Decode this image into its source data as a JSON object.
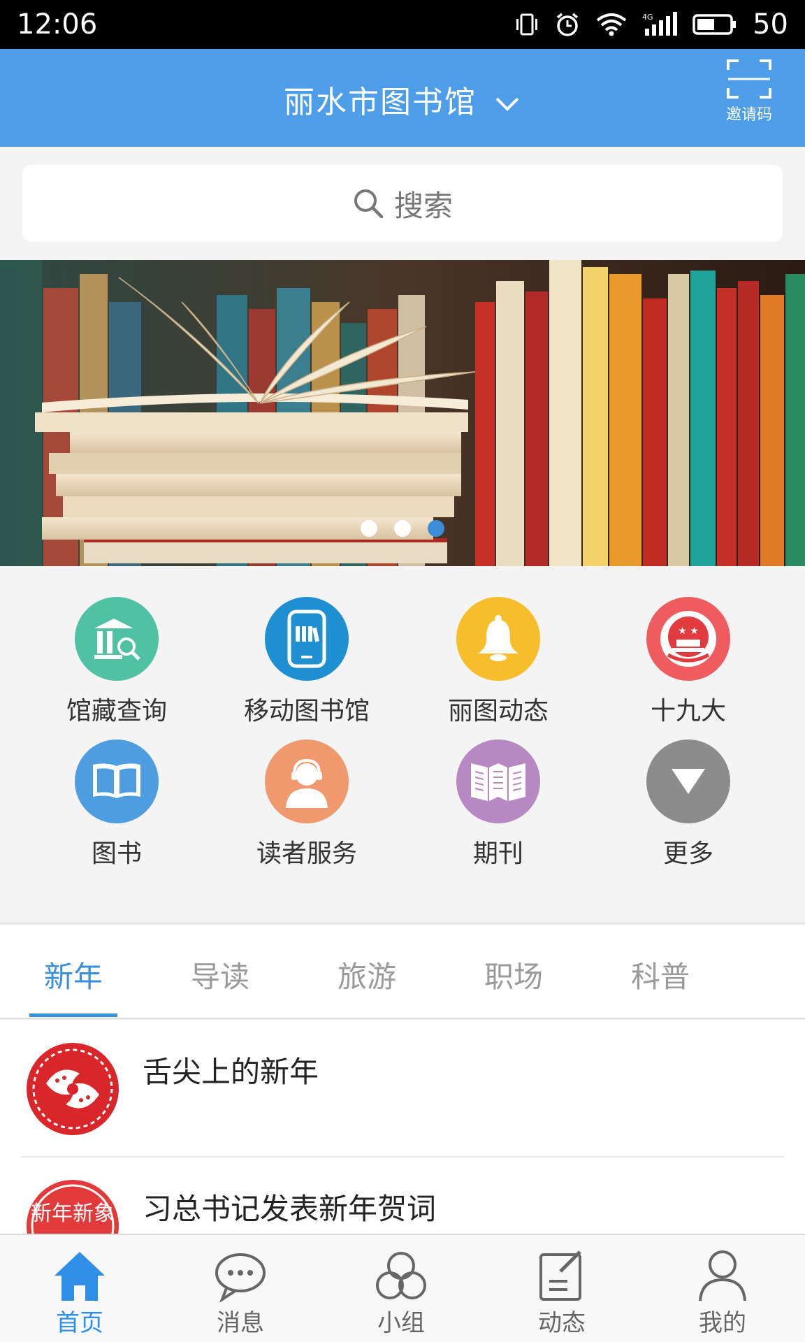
{
  "status_bar": {
    "time": "12:06",
    "network_type": "4G",
    "battery": "50",
    "icons": [
      "vibrate-icon",
      "alarm-icon",
      "wifi-icon",
      "signal-icon",
      "battery-icon"
    ]
  },
  "header": {
    "title": "丽水市图书馆",
    "invite_label": "邀请码"
  },
  "search": {
    "placeholder": "搜索"
  },
  "banner": {
    "slide_count": 3,
    "active_index": 2
  },
  "grid": {
    "items": [
      {
        "label": "馆藏查询",
        "icon": "library-search-icon",
        "color": "#4fc2a4"
      },
      {
        "label": "移动图书馆",
        "icon": "mobile-library-icon",
        "color": "#1e8fd0"
      },
      {
        "label": "丽图动态",
        "icon": "bell-icon",
        "color": "#f7bd2a"
      },
      {
        "label": "十九大",
        "icon": "emblem-icon",
        "color": "#ee5c60"
      },
      {
        "label": "图书",
        "icon": "book-icon",
        "color": "#4e9de0"
      },
      {
        "label": "读者服务",
        "icon": "headset-user-icon",
        "color": "#f0996e"
      },
      {
        "label": "期刊",
        "icon": "magazine-icon",
        "color": "#b789c2"
      },
      {
        "label": "更多",
        "icon": "more-icon",
        "color": "#8c8c8c"
      }
    ]
  },
  "tabs": [
    "新年",
    "导读",
    "旅游",
    "职场",
    "科普"
  ],
  "active_tab": 0,
  "list": [
    {
      "title": "舌尖上的新年",
      "thumb": "paper-cut-fish-icon"
    },
    {
      "title": "习总书记发表新年贺词",
      "thumb": "paper-cut-new-year-icon",
      "thumb_text": "新年新象"
    }
  ],
  "bottom_nav": [
    {
      "label": "首页",
      "icon": "home-icon"
    },
    {
      "label": "消息",
      "icon": "chat-icon"
    },
    {
      "label": "小组",
      "icon": "group-icon"
    },
    {
      "label": "动态",
      "icon": "edit-icon"
    },
    {
      "label": "我的",
      "icon": "user-icon"
    }
  ],
  "colors": {
    "header": "#4d9de8",
    "accent": "#3a8fd8",
    "nav_active": "#2f8fe6"
  }
}
